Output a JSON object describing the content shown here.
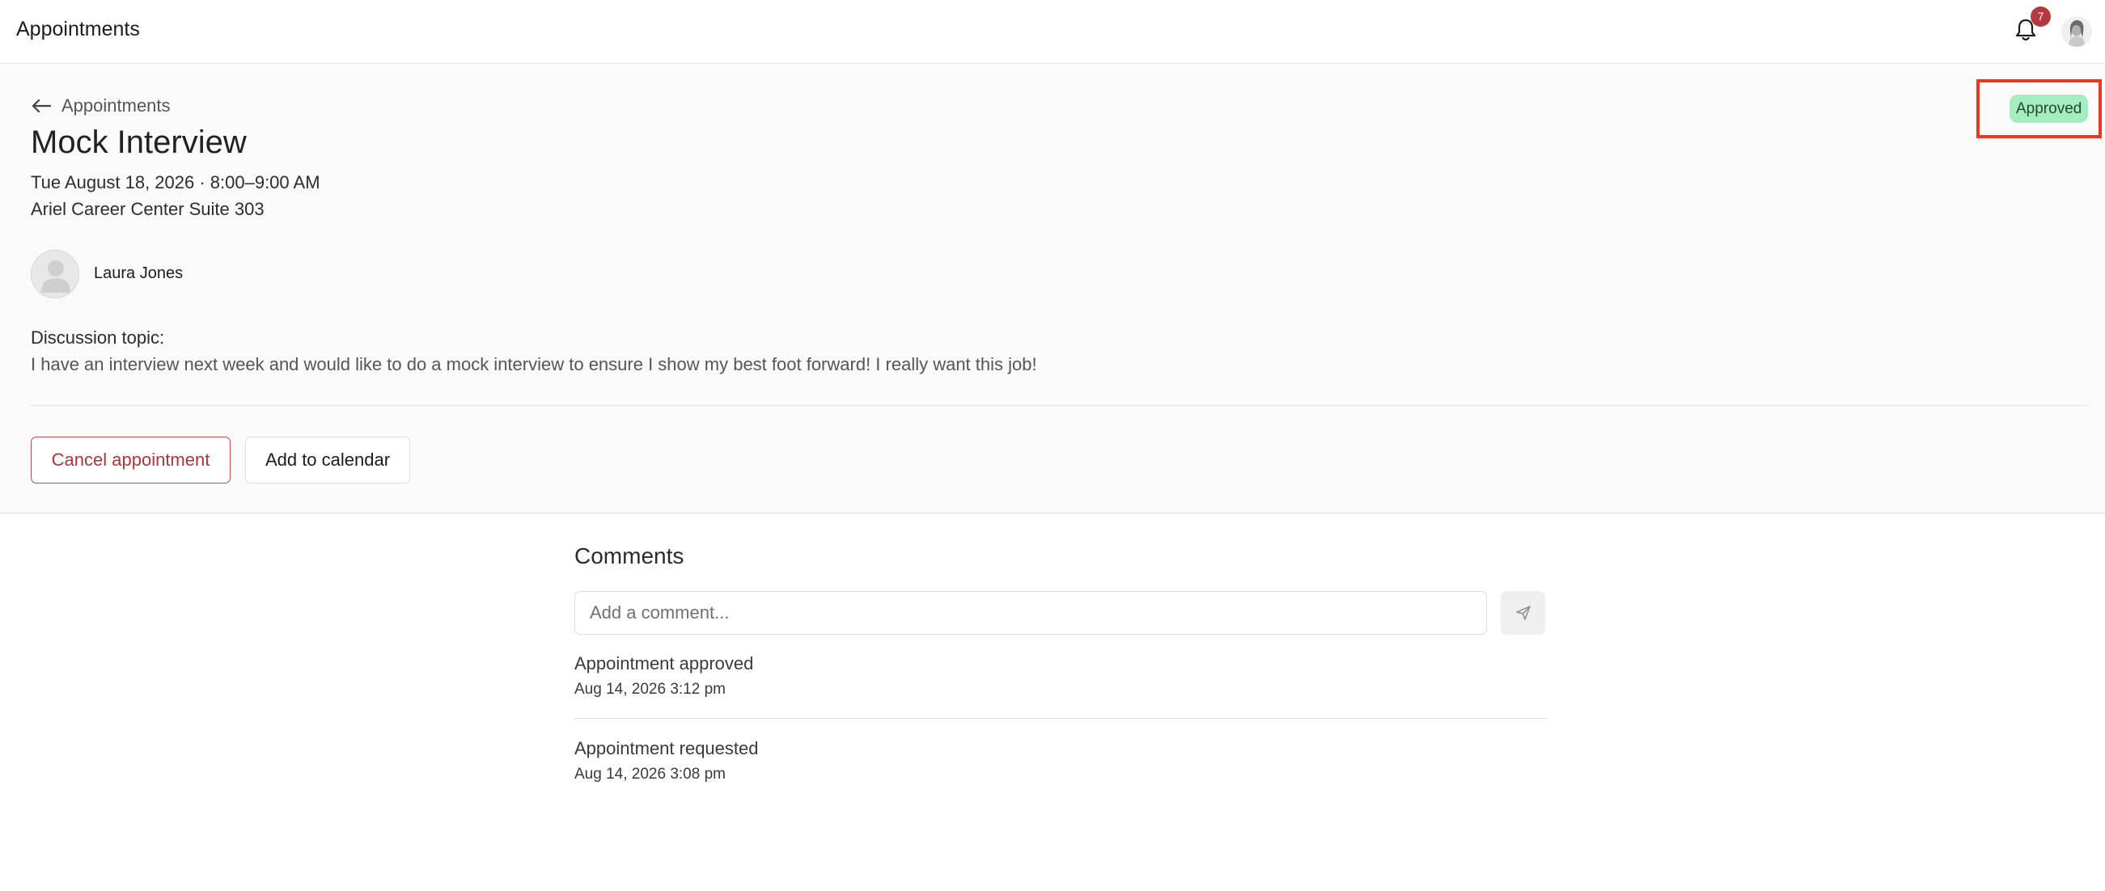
{
  "app": {
    "title": "Appointments"
  },
  "notifications": {
    "count": "7"
  },
  "icons": {
    "bell": "bell-icon",
    "back": "arrow-left-icon",
    "send": "send-icon",
    "avatar": "person-placeholder-icon"
  },
  "colors": {
    "status_bg": "#a6ecc0",
    "status_text": "#1f4d2e",
    "danger": "#b0333b",
    "badge": "#b23a3f",
    "highlight": "#e53a25"
  },
  "detail": {
    "back_label": "Appointments",
    "status": "Approved",
    "title": "Mock Interview",
    "datetime": "Tue August 18, 2026 · 8:00–9:00 AM",
    "location": "Ariel Career Center Suite 303",
    "person_name": "Laura Jones",
    "topic_label": "Discussion topic:",
    "topic_text": "I have an interview next week and would like to do a mock interview to ensure I show my best foot forward! I really want this job!",
    "cancel_label": "Cancel appointment",
    "calendar_label": "Add to calendar"
  },
  "comments": {
    "title": "Comments",
    "placeholder": "Add a comment...",
    "activity": [
      {
        "title": "Appointment approved",
        "time": "Aug 14, 2026 3:12 pm"
      },
      {
        "title": "Appointment requested",
        "time": "Aug 14, 2026 3:08 pm"
      }
    ]
  }
}
